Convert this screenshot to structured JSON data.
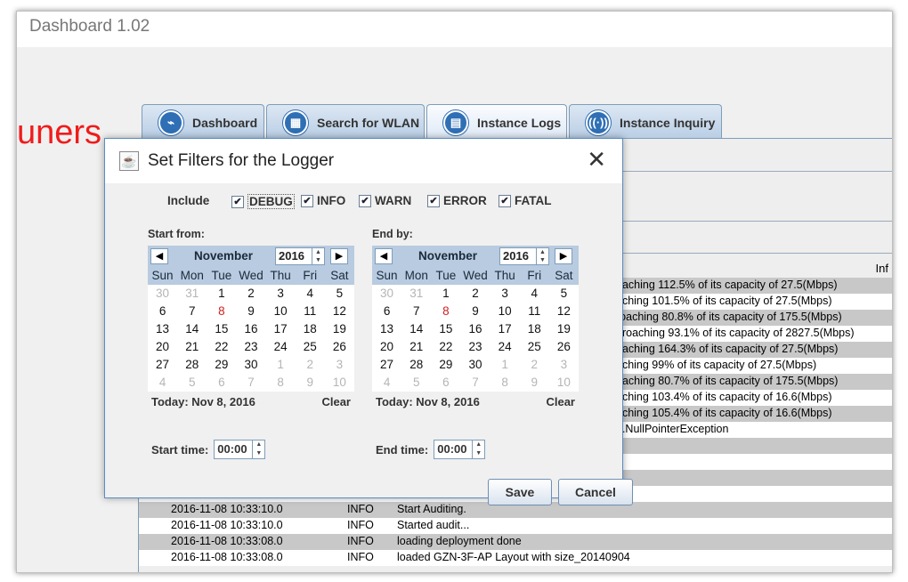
{
  "app": {
    "title": "Dashboard 1.02",
    "brand_fragment": "uners"
  },
  "tabs": [
    {
      "label": "Dashboard",
      "icon": "chart-icon"
    },
    {
      "label": "Search for WLAN",
      "icon": "grid-icon"
    },
    {
      "label": "Instance Logs",
      "icon": "document-icon"
    },
    {
      "label": "Instance Inquiry",
      "icon": "wireless-icon"
    }
  ],
  "logs_right_header": "Inf",
  "log_fragments": [
    "oaching 112.5% of its capacity of 27.5(Mbps)",
    "aching 101.5% of its capacity of 27.5(Mbps)",
    "roaching 80.8% of its capacity of 175.5(Mbps)",
    "proaching 93.1% of its capacity of 2827.5(Mbps)",
    "oaching 164.3% of its capacity of 27.5(Mbps)",
    "aching 99% of its capacity of 27.5(Mbps)",
    "oaching 80.7% of its capacity of 175.5(Mbps)",
    "aching 103.4% of its capacity of 16.6(Mbps)",
    "aching 105.4% of its capacity of 16.6(Mbps)",
    "g.NullPointerException"
  ],
  "log_rows": [
    {
      "time": "2016-11-08 10:33:10.0",
      "level": "INFO",
      "message": "Start Auditing."
    },
    {
      "time": "2016-11-08 10:33:10.0",
      "level": "INFO",
      "message": "Started audit..."
    },
    {
      "time": "2016-11-08 10:33:08.0",
      "level": "INFO",
      "message": "loading deployment done"
    },
    {
      "time": "2016-11-08 10:33:08.0",
      "level": "INFO",
      "message": "loaded GZN-3F-AP Layout with size_20140904"
    }
  ],
  "dialog": {
    "title": "Set Filters for the Logger",
    "close_glyph": "✕",
    "include_label": "Include",
    "levels": [
      {
        "label": "DEBUG",
        "checked": true
      },
      {
        "label": "INFO",
        "checked": true
      },
      {
        "label": "WARN",
        "checked": true
      },
      {
        "label": "ERROR",
        "checked": true
      },
      {
        "label": "FATAL",
        "checked": true
      }
    ],
    "start": {
      "label": "Start from:",
      "month": "November",
      "year": "2016",
      "today": "Today: Nov 8, 2016",
      "clear": "Clear",
      "time_label": "Start time:",
      "time_value": "00:00"
    },
    "end": {
      "label": "End by:",
      "month": "November",
      "year": "2016",
      "today": "Today: Nov 8, 2016",
      "clear": "Clear",
      "time_label": "End time:",
      "time_value": "00:00"
    },
    "weekdays": [
      "Sun",
      "Mon",
      "Tue",
      "Wed",
      "Thu",
      "Fri",
      "Sat"
    ],
    "days": [
      [
        "30",
        "31",
        "1",
        "2",
        "3",
        "4",
        "5"
      ],
      [
        "6",
        "7",
        "8",
        "9",
        "10",
        "11",
        "12"
      ],
      [
        "13",
        "14",
        "15",
        "16",
        "17",
        "18",
        "19"
      ],
      [
        "20",
        "21",
        "22",
        "23",
        "24",
        "25",
        "26"
      ],
      [
        "27",
        "28",
        "29",
        "30",
        "1",
        "2",
        "3"
      ],
      [
        "4",
        "5",
        "6",
        "7",
        "8",
        "9",
        "10"
      ]
    ],
    "save_label": "Save",
    "cancel_label": "Cancel"
  }
}
